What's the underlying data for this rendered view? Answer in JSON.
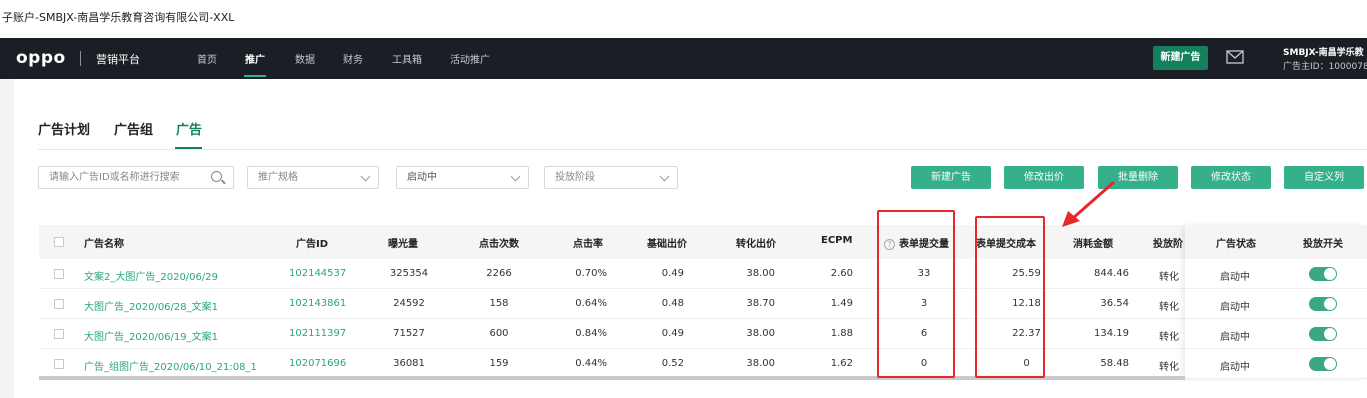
{
  "window_title": "子账户-SMBJX-南昌学乐教育咨询有限公司-XXL",
  "topnav": {
    "logo": "oppo",
    "platform": "营销平台",
    "items": [
      "首页",
      "推广",
      "数据",
      "财务",
      "工具箱",
      "活动推广"
    ],
    "active": "推广",
    "new_button": "新建广告",
    "account_name": "SMBJX-南昌学乐教",
    "account_id": "广告主ID：1000078",
    "accent": "#2ab489"
  },
  "tabs": [
    "广告计划",
    "广告组",
    "广告"
  ],
  "active_tab": "广告",
  "filters": {
    "search_placeholder": "请输入广告ID或名称进行搜索",
    "spec_placeholder": "推广规格",
    "status_value": "启动中",
    "stage_placeholder": "投放阶段"
  },
  "buttons": [
    "新建广告",
    "修改出价",
    "批量删除",
    "修改状态",
    "自定义列"
  ],
  "table": {
    "columns": [
      "广告名称",
      "广告ID",
      "曝光量",
      "点击次数",
      "点击率",
      "基础出价",
      "转化出价",
      "ECPM",
      "表单提交量",
      "表单提交成本",
      "消耗金额",
      "投放阶",
      "广告状态",
      "投放开关"
    ],
    "rows": [
      {
        "name": "文案2_大图广告_2020/06/29",
        "id": "102144537",
        "exposure": "325354",
        "clicks": "2266",
        "ctr": "0.70%",
        "base_bid": "0.49",
        "conv_bid": "38.00",
        "ecpm": "2.60",
        "forms": "33",
        "form_cost": "25.59",
        "spend": "844.46",
        "stage": "转化",
        "status": "启动中",
        "switch_on": true
      },
      {
        "name": "大图广告_2020/06/28_文案1",
        "id": "102143861",
        "exposure": "24592",
        "clicks": "158",
        "ctr": "0.64%",
        "base_bid": "0.48",
        "conv_bid": "38.70",
        "ecpm": "1.49",
        "forms": "3",
        "form_cost": "12.18",
        "spend": "36.54",
        "stage": "转化",
        "status": "启动中",
        "switch_on": true
      },
      {
        "name": "大图广告_2020/06/19_文案1",
        "id": "102111397",
        "exposure": "71527",
        "clicks": "600",
        "ctr": "0.84%",
        "base_bid": "0.49",
        "conv_bid": "38.00",
        "ecpm": "1.88",
        "forms": "6",
        "form_cost": "22.37",
        "spend": "134.19",
        "stage": "转化",
        "status": "启动中",
        "switch_on": true
      },
      {
        "name": "广告_组图广告_2020/06/10_21:08_1",
        "id": "102071696",
        "exposure": "36081",
        "clicks": "159",
        "ctr": "0.44%",
        "base_bid": "0.52",
        "conv_bid": "38.00",
        "ecpm": "1.62",
        "forms": "0",
        "form_cost": "0",
        "spend": "58.48",
        "stage": "转化",
        "status": "启动中",
        "switch_on": true
      }
    ]
  },
  "colors": {
    "link_green": "#2aa779",
    "button_green": "#35b08b",
    "highlight_red": "#e8262b",
    "nav_bg": "#1b1e24"
  }
}
